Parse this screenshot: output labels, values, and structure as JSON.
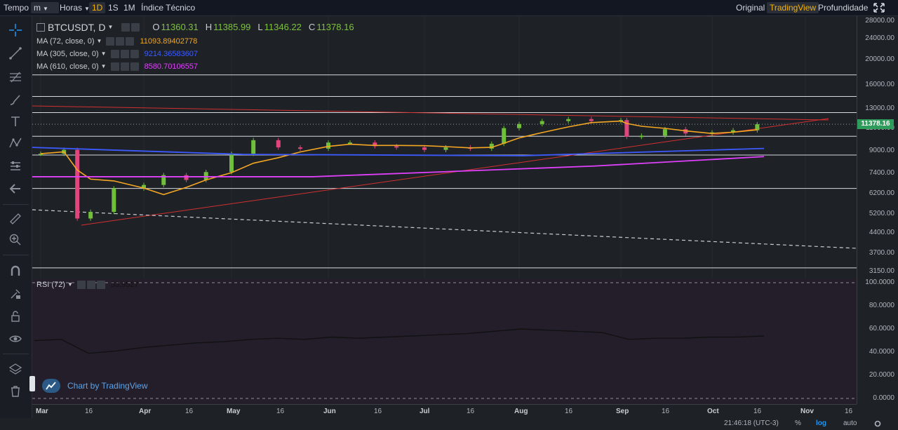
{
  "topbar": {
    "tempo_label": "Tempo",
    "interval_unit": "m",
    "horas_label": "Horas",
    "range_1d": "1D",
    "range_1s": "1S",
    "range_1m": "1M",
    "indice_label": "Índice Técnico",
    "view_original": "Original",
    "view_tradingview": "TradingView",
    "view_profundidade": "Profundidade"
  },
  "legend": {
    "symbol": "BTCUSDT, D",
    "open_label": "O",
    "open": "11360.31",
    "high_label": "H",
    "high": "11385.99",
    "low_label": "L",
    "low": "11346.22",
    "close_label": "C",
    "close": "11378.16",
    "ma1_label": "MA (72, close, 0)",
    "ma1_value": "11093.89402778",
    "ma1_color": "#f5a623",
    "ma2_label": "MA (305, close, 0)",
    "ma2_value": "9214.36583607",
    "ma2_color": "#3d5afe",
    "ma3_label": "MA (610, close, 0)",
    "ma3_value": "8580.70106557",
    "ma3_color": "#e040fb",
    "rsi_label": "RSI (72)",
    "rsi_value": "53.9527"
  },
  "price_scale": [
    "28000.00",
    "24000.00",
    "20000.00",
    "16000.00",
    "13000.00",
    "11000.00",
    "9000.00",
    "7400.00",
    "6200.00",
    "5200.00",
    "4400.00",
    "3700.00",
    "3150.00"
  ],
  "current_price": "11378.16",
  "rsi_scale": [
    "100.0000",
    "80.0000",
    "60.0000",
    "40.0000",
    "20.0000",
    "0.0000"
  ],
  "time_scale": [
    {
      "label": "Mar",
      "bold": true
    },
    {
      "label": "16",
      "bold": false
    },
    {
      "label": "Apr",
      "bold": true
    },
    {
      "label": "16",
      "bold": false
    },
    {
      "label": "May",
      "bold": true
    },
    {
      "label": "16",
      "bold": false
    },
    {
      "label": "Jun",
      "bold": true
    },
    {
      "label": "16",
      "bold": false
    },
    {
      "label": "Jul",
      "bold": true
    },
    {
      "label": "16",
      "bold": false
    },
    {
      "label": "Aug",
      "bold": true
    },
    {
      "label": "16",
      "bold": false
    },
    {
      "label": "Sep",
      "bold": true
    },
    {
      "label": "16",
      "bold": false
    },
    {
      "label": "Oct",
      "bold": true
    },
    {
      "label": "16",
      "bold": false
    },
    {
      "label": "Nov",
      "bold": true
    },
    {
      "label": "16",
      "bold": false
    }
  ],
  "watermark": "Chart by TradingView",
  "statusbar": {
    "clock": "21:46:18 (UTC-3)",
    "percent": "%",
    "log": "log",
    "auto": "auto"
  },
  "colors": {
    "up": "#6fbf3a",
    "down": "#e0457b",
    "ma72": "#f5a623",
    "ma305": "#3d5afe",
    "ma610": "#e040fb",
    "trend_red": "#d32f2f",
    "rsi_line": "#111111",
    "accent": "#f7b500"
  },
  "icons": [
    "crosshair-icon",
    "trend-line-icon",
    "fib-icon",
    "brush-icon",
    "text-icon",
    "pattern-icon",
    "forecast-icon",
    "back-arrow-icon",
    "ruler-icon",
    "zoom-in-icon",
    "magnet-icon",
    "lock-draw-icon",
    "lock-icon",
    "eye-icon",
    "layers-icon",
    "trash-icon",
    "fullscreen-icon",
    "gear-icon",
    "camera-icon"
  ],
  "chart_data": {
    "type": "candlestick",
    "symbol": "BTCUSDT",
    "interval": "D",
    "scale": "log",
    "ylim": [
      3150,
      28000
    ],
    "x": [
      "Mar",
      "Apr",
      "May",
      "Jun",
      "Jul",
      "Aug",
      "Sep",
      "Oct",
      "Nov"
    ],
    "close_series": [
      [
        "Mar 1",
        8800
      ],
      [
        "Mar 8",
        9100
      ],
      [
        "Mar 12",
        5000
      ],
      [
        "Mar 16",
        5300
      ],
      [
        "Mar 23",
        6500
      ],
      [
        "Apr 1",
        6700
      ],
      [
        "Apr 8",
        7300
      ],
      [
        "Apr 16",
        7000
      ],
      [
        "Apr 23",
        7500
      ],
      [
        "May 1",
        8800
      ],
      [
        "May 8",
        9900
      ],
      [
        "May 16",
        9300
      ],
      [
        "May 23",
        9200
      ],
      [
        "Jun 1",
        9700
      ],
      [
        "Jun 8",
        9700
      ],
      [
        "Jun 16",
        9400
      ],
      [
        "Jun 23",
        9300
      ],
      [
        "Jul 1",
        9100
      ],
      [
        "Jul 8",
        9300
      ],
      [
        "Jul 16",
        9200
      ],
      [
        "Jul 23",
        9600
      ],
      [
        "Jul 27",
        11000
      ],
      [
        "Aug 1",
        11400
      ],
      [
        "Aug 8",
        11700
      ],
      [
        "Aug 16",
        11900
      ],
      [
        "Aug 23",
        11700
      ],
      [
        "Sep 1",
        11800
      ],
      [
        "Sep 3",
        10200
      ],
      [
        "Sep 8",
        10300
      ],
      [
        "Sep 16",
        10900
      ],
      [
        "Sep 23",
        10500
      ],
      [
        "Oct 1",
        10600
      ],
      [
        "Oct 8",
        10800
      ],
      [
        "Oct 16",
        11378.16
      ]
    ],
    "horizontal_levels": [
      17500,
      14500,
      12600,
      10250,
      8700,
      6500,
      3250
    ],
    "moving_averages": [
      {
        "name": "MA (72, close, 0)",
        "last": 11093.89402778
      },
      {
        "name": "MA (305, close, 0)",
        "last": 9214.36583607
      },
      {
        "name": "MA (610, close, 0)",
        "last": 8580.70106557
      }
    ],
    "rsi": {
      "name": "RSI (72)",
      "last": 53.9527,
      "ylim": [
        0,
        100
      ],
      "values": [
        50,
        51,
        39,
        41,
        44,
        46,
        48,
        49,
        51,
        52,
        51,
        53,
        52,
        53,
        54,
        55,
        56,
        58,
        60,
        59,
        58,
        57,
        51,
        52,
        52,
        53,
        53,
        54
      ]
    }
  }
}
